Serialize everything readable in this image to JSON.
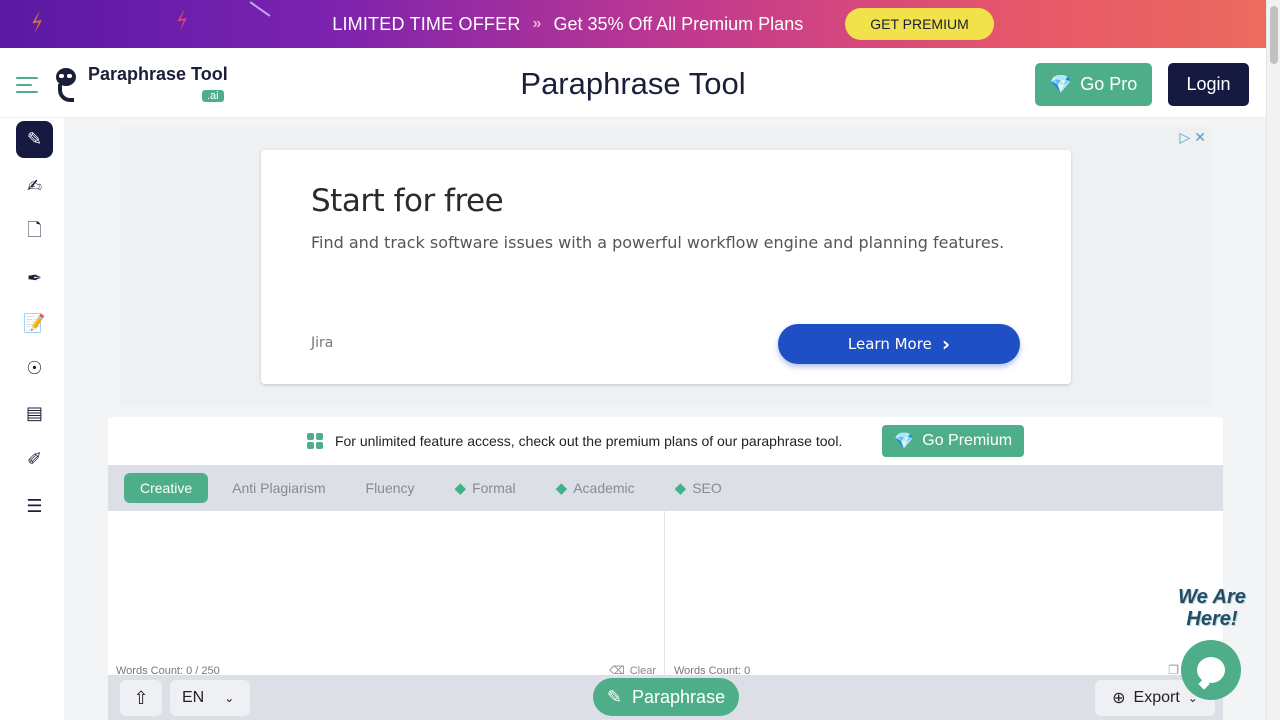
{
  "promo": {
    "headline": "LIMITED TIME OFFER",
    "chevrons": "»",
    "offer": "Get 35% Off All Premium Plans",
    "button": "GET PREMIUM"
  },
  "header": {
    "logo_text": "Paraphrase Tool",
    "logo_badge": ".ai",
    "title": "Paraphrase Tool",
    "go_pro": "Go Pro",
    "login": "Login"
  },
  "rail": {
    "items": [
      {
        "name": "paraphrase-tool",
        "glyph": "✎",
        "active": true
      },
      {
        "name": "ai-writer",
        "glyph": "✍"
      },
      {
        "name": "plagiarism-checker",
        "glyph": "🗋"
      },
      {
        "name": "summarizer",
        "glyph": "✒"
      },
      {
        "name": "essay-writer",
        "glyph": "📝"
      },
      {
        "name": "ai-detector",
        "glyph": "☉"
      },
      {
        "name": "document-tool",
        "glyph": "▤"
      },
      {
        "name": "grammar-checker",
        "glyph": "✐"
      },
      {
        "name": "text-editor",
        "glyph": "☰"
      }
    ]
  },
  "ad": {
    "title": "Start for free",
    "description": "Find and track software issues with a powerful workflow engine and planning features.",
    "brand": "Jira",
    "cta": "Learn More",
    "cta_icon": "›",
    "adchoices_icon": "▷",
    "close_icon": "✕"
  },
  "tool": {
    "notice": "For unlimited feature access, check out the premium plans of our paraphrase tool.",
    "go_premium": "Go Premium",
    "modes": [
      {
        "label": "Creative",
        "active": true,
        "premium": false
      },
      {
        "label": "Anti Plagiarism",
        "premium": false
      },
      {
        "label": "Fluency",
        "premium": false
      },
      {
        "label": "Formal",
        "premium": true
      },
      {
        "label": "Academic",
        "premium": true
      },
      {
        "label": "SEO",
        "premium": true
      }
    ],
    "input_word_count": "Words Count: 0 / 250",
    "clear": "Clear",
    "output_word_count": "Words Count: 0",
    "language": "EN",
    "paraphrase": "Paraphrase",
    "export": "Export"
  },
  "chat": {
    "tagline_1": "We Are",
    "tagline_2": "Here!"
  },
  "colors": {
    "accent": "#4fae8a",
    "navy": "#161a40",
    "ad_button": "#1f4fc4",
    "promo_button": "#f1e14a"
  }
}
